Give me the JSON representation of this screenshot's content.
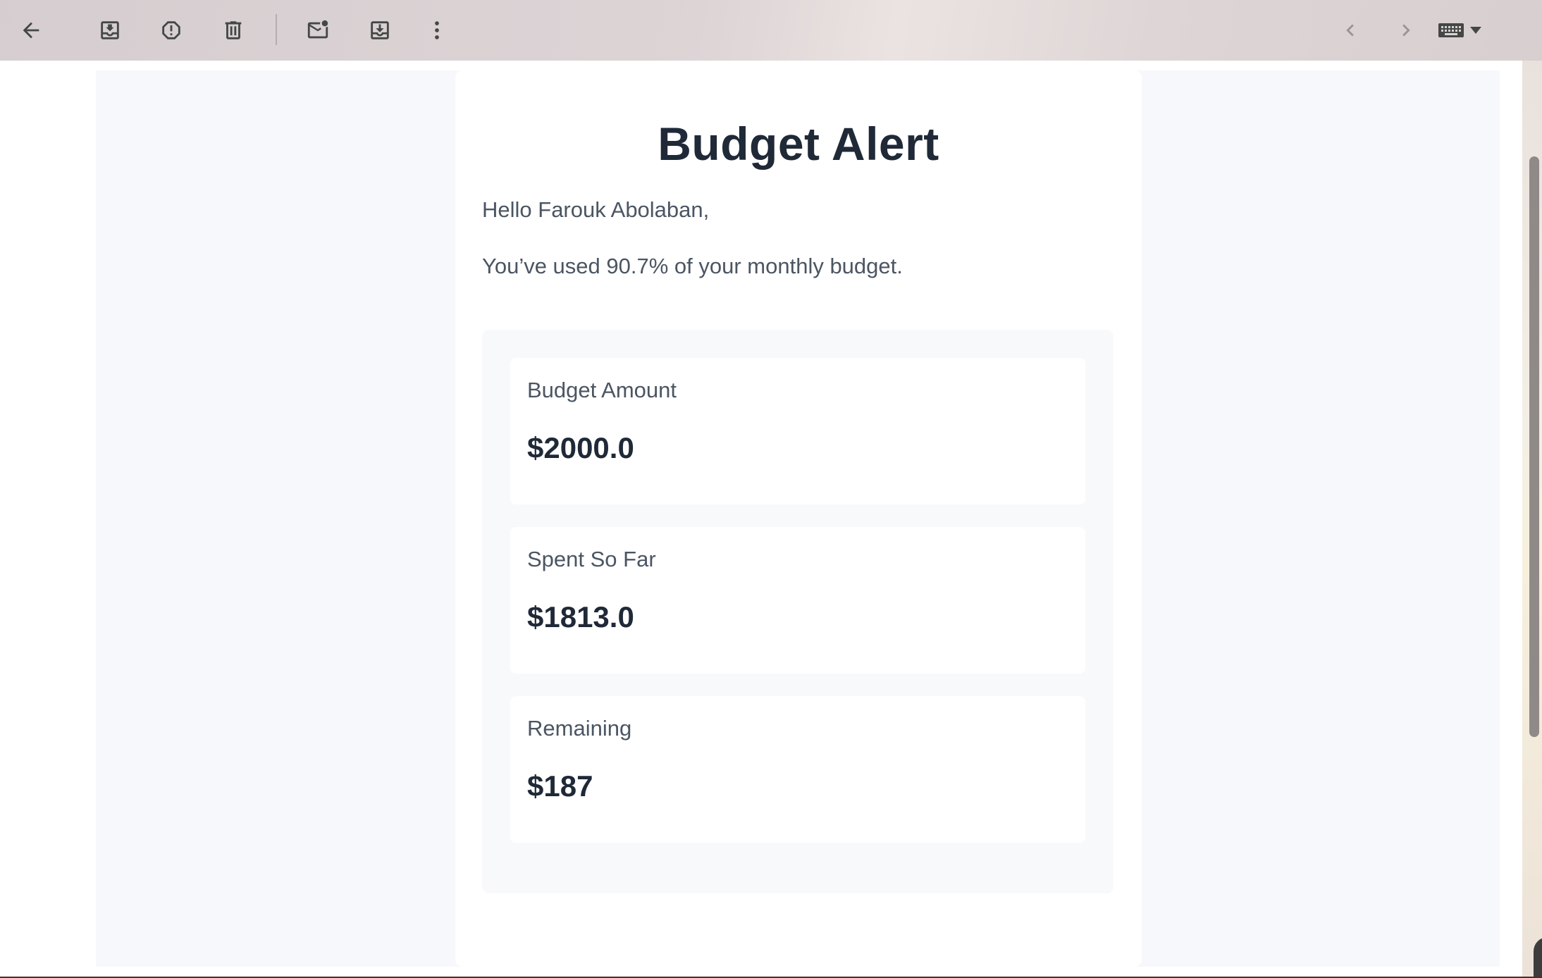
{
  "toolbar": {
    "buttons": [
      {
        "name": "back-arrow-icon"
      },
      {
        "name": "archive-icon"
      },
      {
        "name": "report-spam-icon"
      },
      {
        "name": "delete-icon"
      },
      {
        "name": "mark-unread-icon"
      },
      {
        "name": "move-to-icon"
      },
      {
        "name": "more-options-icon"
      }
    ],
    "nav": [
      {
        "name": "newer-chevron-left-icon"
      },
      {
        "name": "older-chevron-right-icon"
      }
    ],
    "input_tools": {
      "name": "keyboard-icon",
      "dropdown": "caret-down-icon"
    }
  },
  "email": {
    "title": "Budget Alert",
    "greeting": "Hello Farouk Abolaban,",
    "message": "You’ve used 90.7% of your monthly budget.",
    "usage_percent": 90.7,
    "stats": [
      {
        "label": "Budget Amount",
        "value": "$2000.0"
      },
      {
        "label": "Spent So Far",
        "value": "$1813.0"
      },
      {
        "label": "Remaining",
        "value": "$187"
      }
    ]
  },
  "colors": {
    "heading": "#1f2937",
    "body_text": "#4b5563",
    "panel_bg": "#f8f9fb",
    "outer_bg": "#f7f8fb",
    "icon": "#444746"
  }
}
